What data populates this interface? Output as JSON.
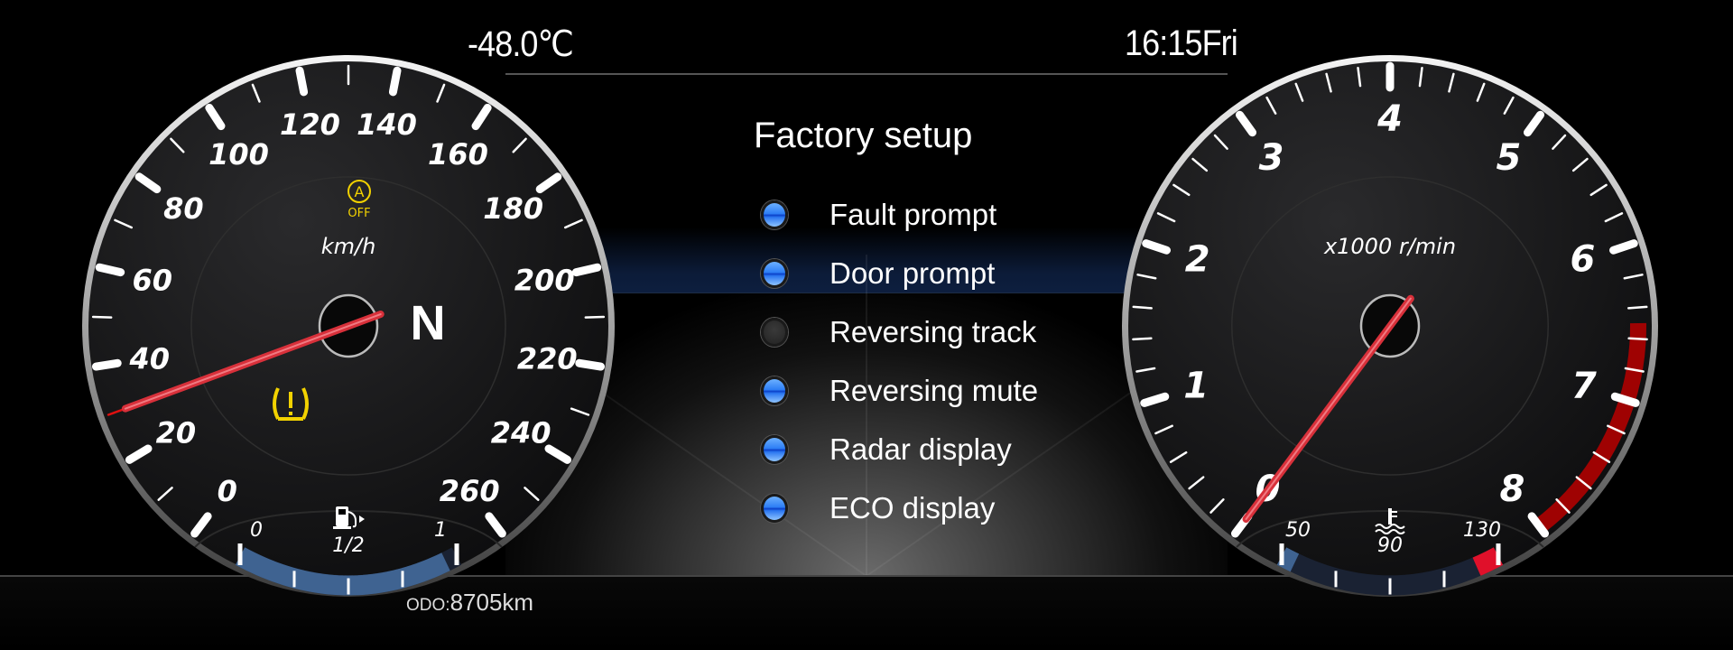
{
  "header": {
    "outside_temperature": "-48.0℃",
    "clock": "16:15Fri"
  },
  "odometer": {
    "label": "ODO:",
    "value": "8705km"
  },
  "menu": {
    "title": "Factory setup",
    "selected_index": 1,
    "items": [
      {
        "label": "Fault prompt",
        "enabled": true
      },
      {
        "label": "Door prompt",
        "enabled": true
      },
      {
        "label": "Reversing track",
        "enabled": false
      },
      {
        "label": "Reversing mute",
        "enabled": true
      },
      {
        "label": "Radar display",
        "enabled": true
      },
      {
        "label": "ECO display",
        "enabled": true
      }
    ]
  },
  "speedometer": {
    "unit": "km/h",
    "min": 0,
    "max": 260,
    "tick_labels": [
      "0",
      "20",
      "40",
      "60",
      "80",
      "100",
      "120",
      "140",
      "160",
      "180",
      "200",
      "220",
      "240",
      "260"
    ],
    "current_speed": 30,
    "gear": "N",
    "warning_icons": [
      "auto-start-stop-off-icon",
      "tire-pressure-warning-icon"
    ],
    "auto_stop_label": "OFF",
    "fuel": {
      "labels": [
        "0",
        "1/2",
        "1"
      ],
      "level_fraction": 0.95,
      "icon": "fuel-pump-icon"
    }
  },
  "tachometer": {
    "unit": "x1000 r/min",
    "min": 0,
    "max": 8,
    "tick_labels": [
      "0",
      "1",
      "2",
      "3",
      "4",
      "5",
      "6",
      "7",
      "8"
    ],
    "current_rpm_thousands": 0,
    "redline_from": 6.5,
    "coolant": {
      "labels": [
        "50",
        "90",
        "130"
      ],
      "current_c": 50,
      "icon": "coolant-temperature-icon"
    }
  },
  "colors": {
    "needle": "#d8303a",
    "indicator_on": "#2d7ef5",
    "warning_yellow": "#f2d200",
    "redline": "#c00000",
    "fuel_band": "#3f6391"
  }
}
